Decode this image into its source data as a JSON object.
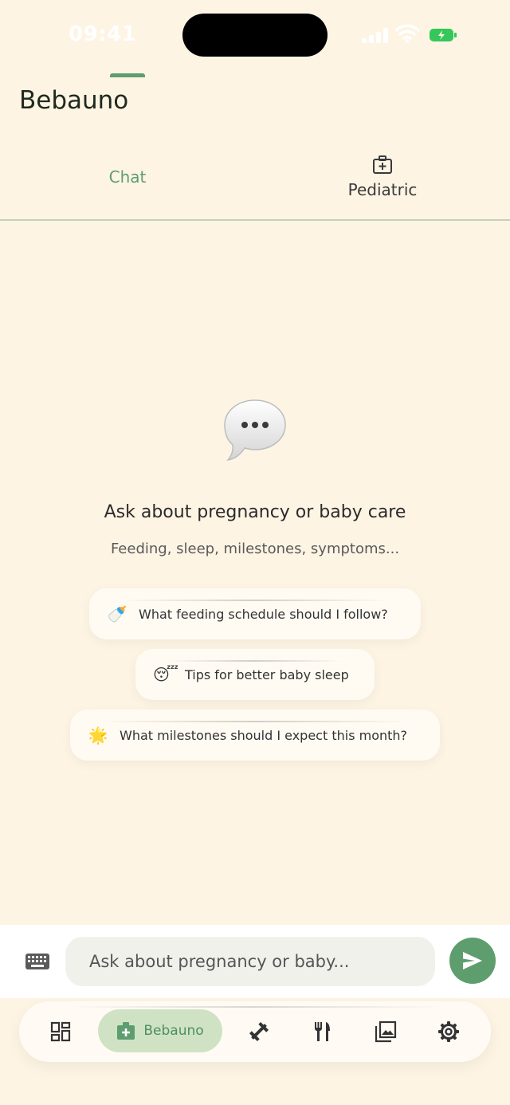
{
  "status_bar": {
    "time": "09:41",
    "signal_icon": "cellular-signal-icon",
    "wifi_icon": "wifi-icon",
    "battery_icon": "battery-charging-icon"
  },
  "app": {
    "title": "Bebauno"
  },
  "tabs": [
    {
      "label": "Chat",
      "active": true
    },
    {
      "label": "Pediatric",
      "icon": "medical-kit-icon",
      "active": false
    }
  ],
  "empty_state": {
    "icon": "speech-bubble-icon",
    "title": "Ask about pregnancy or baby care",
    "subtitle": "Feeding, sleep, milestones, symptoms..."
  },
  "suggestions": [
    {
      "emoji": "🍼",
      "text": "What feeding schedule should I follow?"
    },
    {
      "emoji": "😴",
      "text": "Tips for better baby sleep"
    },
    {
      "emoji": "🌟",
      "text": "What milestones should I expect this month?"
    }
  ],
  "composer": {
    "placeholder": "Ask about pregnancy or baby...",
    "value": "",
    "keyboard_icon": "keyboard-icon",
    "send_icon": "send-icon"
  },
  "bottom_nav": [
    {
      "icon": "dashboard-icon",
      "label": ""
    },
    {
      "icon": "medical-kit-icon",
      "label": "Bebauno",
      "active": true
    },
    {
      "icon": "dumbbell-icon",
      "label": ""
    },
    {
      "icon": "fork-knife-icon",
      "label": ""
    },
    {
      "icon": "gallery-icon",
      "label": ""
    },
    {
      "icon": "gear-icon",
      "label": ""
    }
  ],
  "colors": {
    "accent": "#5E9E6E",
    "background": "#FDF4E4",
    "active_pill": "#CFE3C4"
  }
}
